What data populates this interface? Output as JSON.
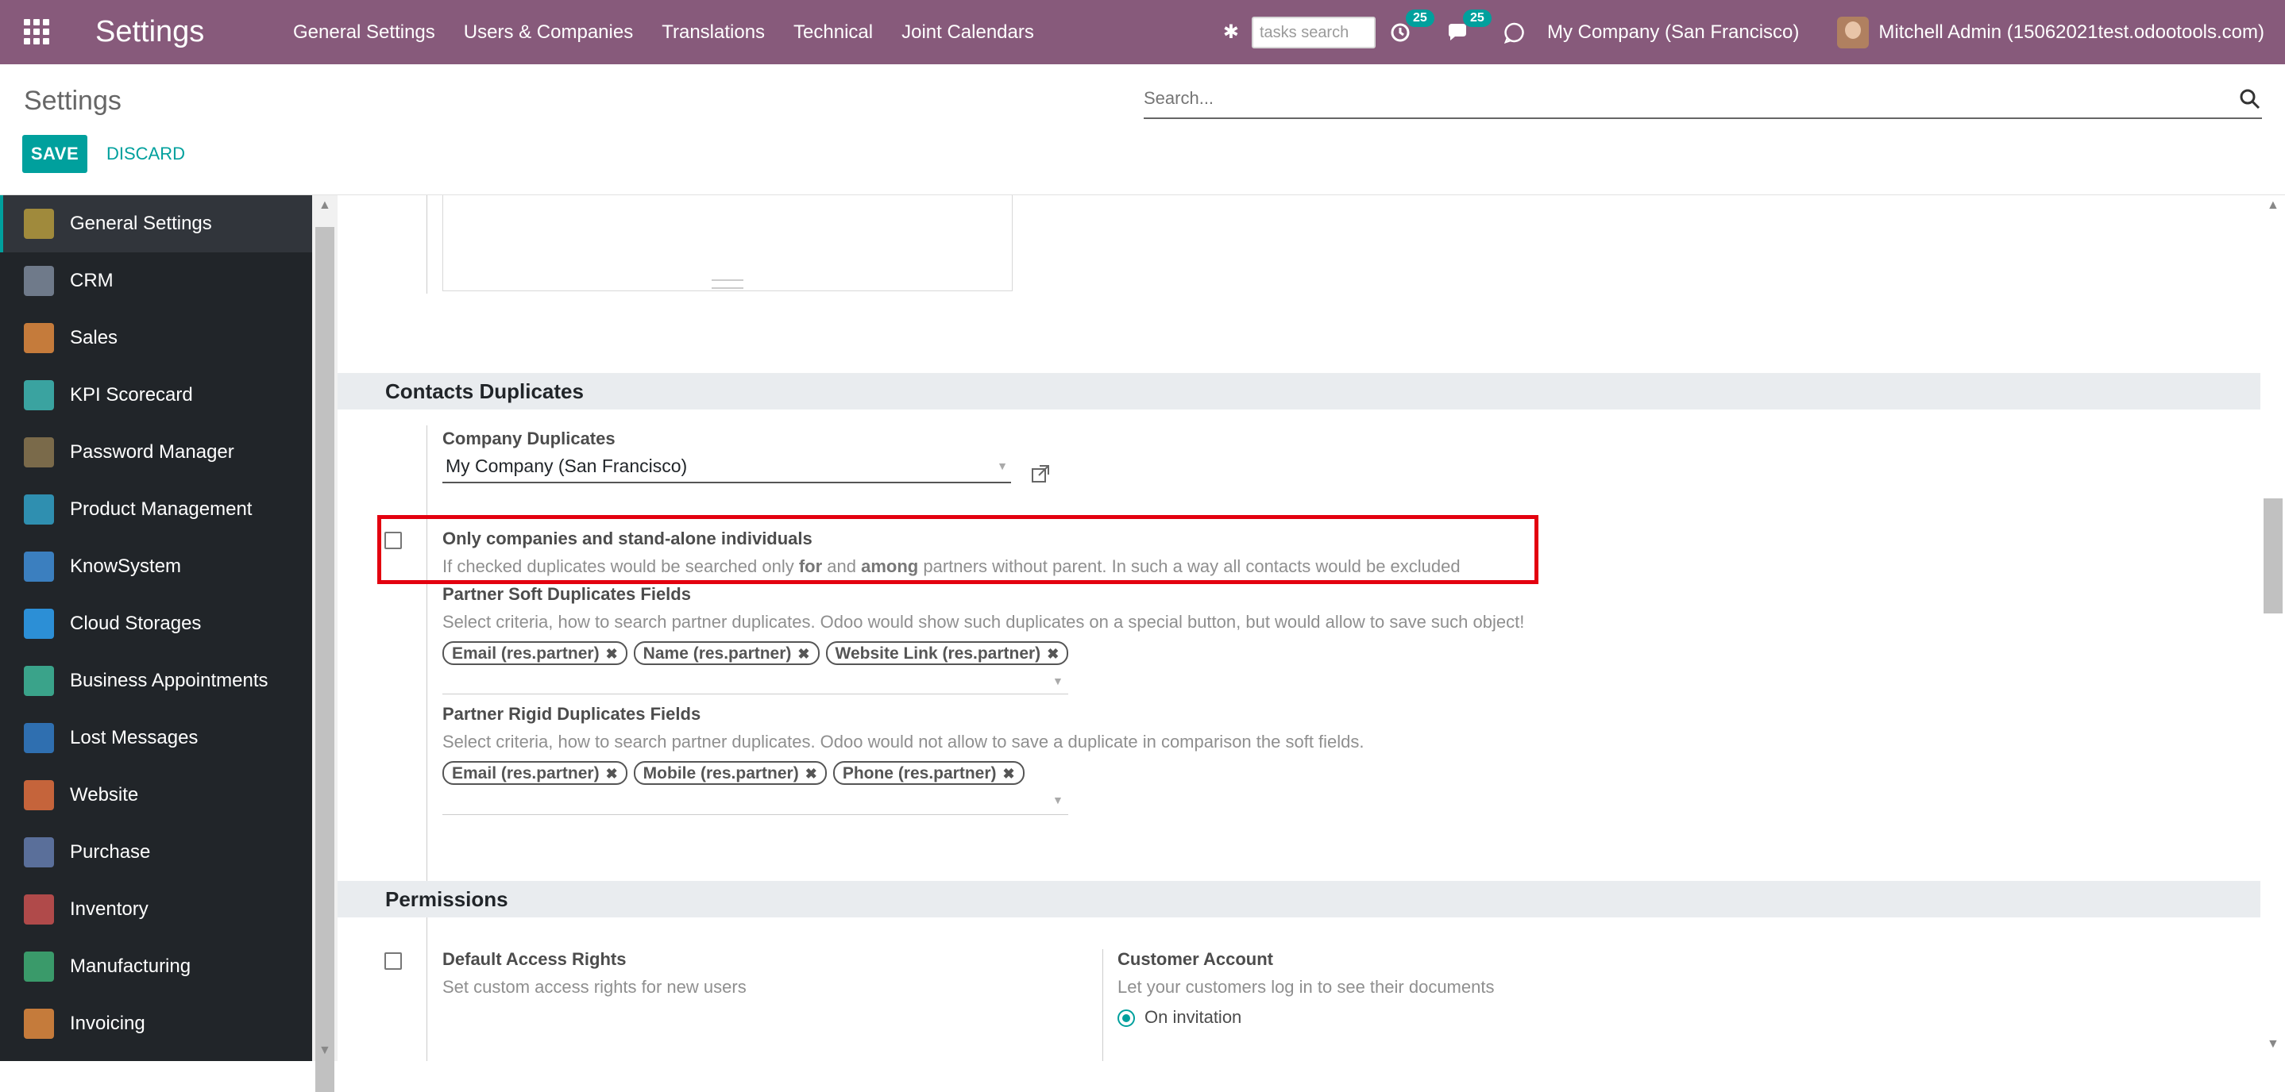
{
  "navbar": {
    "brand": "Settings",
    "menu": [
      "General Settings",
      "Users & Companies",
      "Translations",
      "Technical",
      "Joint Calendars"
    ],
    "tasks_placeholder": "tasks search",
    "activity_count": "25",
    "messages_count": "25",
    "company": "My Company (San Francisco)",
    "user": "Mitchell Admin (15062021test.odootools.com)"
  },
  "control_panel": {
    "title": "Settings",
    "save_label": "SAVE",
    "discard_label": "DISCARD",
    "search_placeholder": "Search..."
  },
  "sidebar": {
    "items": [
      {
        "label": "General Settings",
        "icon": "gear-icon",
        "color": "#a08a3c"
      },
      {
        "label": "CRM",
        "icon": "handshake-icon",
        "color": "#6f7a8a"
      },
      {
        "label": "Sales",
        "icon": "chart-line-icon",
        "color": "#c57b3b"
      },
      {
        "label": "KPI Scorecard",
        "icon": "scorecard-icon",
        "color": "#3aa3a0"
      },
      {
        "label": "Password Manager",
        "icon": "keys-icon",
        "color": "#7a6a4a"
      },
      {
        "label": "Product Management",
        "icon": "grid-icon",
        "color": "#2f8fb0"
      },
      {
        "label": "KnowSystem",
        "icon": "brain-icon",
        "color": "#3b7fbf"
      },
      {
        "label": "Cloud Storages",
        "icon": "cloud-icon",
        "color": "#2c8fd6"
      },
      {
        "label": "Business Appointments",
        "icon": "clock-icon",
        "color": "#3aa38a"
      },
      {
        "label": "Lost Messages",
        "icon": "person-question-icon",
        "color": "#2f6fb0"
      },
      {
        "label": "Website",
        "icon": "globe-icon",
        "color": "#c5643b"
      },
      {
        "label": "Purchase",
        "icon": "card-icon",
        "color": "#5a6f9a"
      },
      {
        "label": "Inventory",
        "icon": "box-icon",
        "color": "#b04a4a"
      },
      {
        "label": "Manufacturing",
        "icon": "wrench-icon",
        "color": "#3a9a6a"
      },
      {
        "label": "Invoicing",
        "icon": "invoice-icon",
        "color": "#c57b3b"
      }
    ]
  },
  "contacts_duplicates": {
    "title": "Contacts Duplicates",
    "company_duplicates_label": "Company Duplicates",
    "company_duplicates_value": "My Company (San Francisco)",
    "only_companies_label": "Only companies and stand-alone individuals",
    "only_companies_desc_1": "If checked duplicates would be searched only ",
    "only_companies_desc_for": "for",
    "only_companies_desc_2": " and ",
    "only_companies_desc_among": "among",
    "only_companies_desc_3": " partners without parent. In such a way all contacts would be excluded",
    "only_companies_checked": false,
    "soft_label": "Partner Soft Duplicates Fields",
    "soft_desc": "Select criteria, how to search partner duplicates. Odoo would show such duplicates on a special button, but would allow to save such object!",
    "soft_tags": [
      "Email (res.partner)",
      "Name (res.partner)",
      "Website Link (res.partner)"
    ],
    "rigid_label": "Partner Rigid Duplicates Fields",
    "rigid_desc": "Select criteria, how to search partner duplicates. Odoo would not allow to save a duplicate in comparison the soft fields.",
    "rigid_tags": [
      "Email (res.partner)",
      "Mobile (res.partner)",
      "Phone (res.partner)"
    ]
  },
  "permissions": {
    "title": "Permissions",
    "default_access_label": "Default Access Rights",
    "default_access_desc": "Set custom access rights for new users",
    "customer_account_label": "Customer Account",
    "customer_account_desc": "Let your customers log in to see their documents",
    "on_invitation": "On invitation"
  },
  "colors": {
    "navbar": "#875a7b",
    "accent": "#00a09d",
    "sidebar": "#212529",
    "highlight": "#e3000f"
  }
}
